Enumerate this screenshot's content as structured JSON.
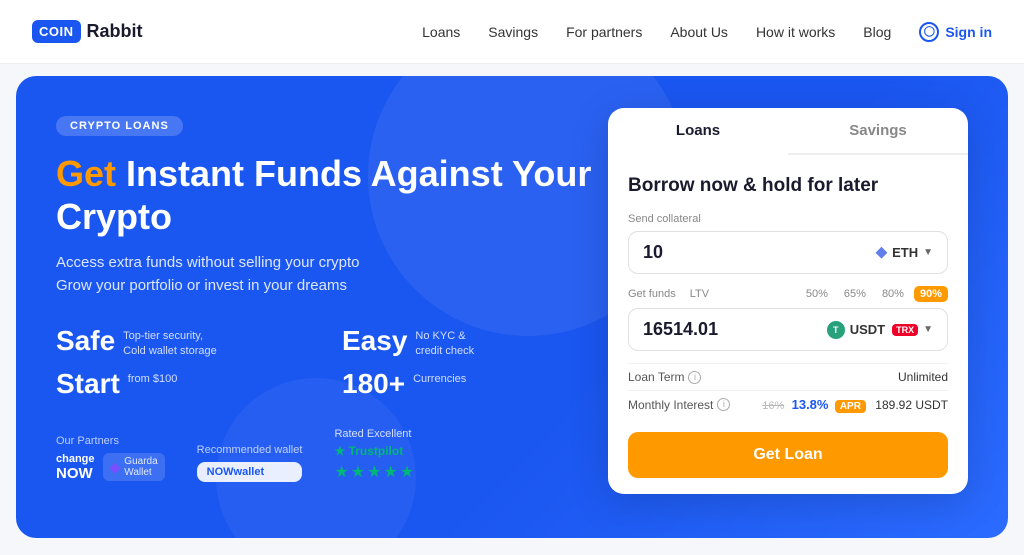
{
  "header": {
    "logo_box": "COIN",
    "logo_text": "Rabbit",
    "nav": {
      "loans": "Loans",
      "savings": "Savings",
      "for_partners": "For partners",
      "about_us": "About Us",
      "how_it_works": "How it works",
      "blog": "Blog",
      "sign_in": "Sign in"
    }
  },
  "hero": {
    "badge": "CRYPTO LOANS",
    "title_highlight": "Get",
    "title_rest": " Instant Funds Against Your Crypto",
    "subtitle_line1": "Access extra funds without selling your crypto",
    "subtitle_line2": "Grow your portfolio or invest in your dreams",
    "features": [
      {
        "big": "Safe",
        "desc": "Top-tier security,\nCold wallet storage"
      },
      {
        "big": "Easy",
        "desc": "No KYC &\ncredit check"
      },
      {
        "big": "Start",
        "desc": "from $100"
      },
      {
        "big": "180+",
        "desc": "Currencies"
      }
    ],
    "partners": {
      "label": "Our Partners",
      "logos": [
        "change NOW",
        "Guarda Wallet"
      ]
    },
    "wallet": {
      "label": "Recommended wallet",
      "name": "NOWwallet"
    },
    "trustpilot": {
      "label": "Rated Excellent",
      "brand": "★ Trustpilot",
      "stars": "★★★★★"
    }
  },
  "card": {
    "tabs": [
      "Loans",
      "Savings"
    ],
    "active_tab": 0,
    "heading": "Borrow now & hold for later",
    "collateral_label": "Send collateral",
    "collateral_value": "10",
    "collateral_currency": "ETH",
    "funds_label": "Get funds",
    "funds_value": "16514.01",
    "funds_currency": "USDT",
    "funds_currency2": "TRX",
    "ltv_label": "LTV",
    "ltv_options": [
      "50%",
      "65%",
      "80%",
      "90%"
    ],
    "ltv_active": "90%",
    "loan_term_label": "Loan Term",
    "loan_term_value": "Unlimited",
    "monthly_interest_label": "Monthly Interest",
    "interest_old": "16%",
    "interest_new": "13.8% APR",
    "interest_usdt": "189.92 USDT",
    "btn_label": "Get Loan"
  }
}
